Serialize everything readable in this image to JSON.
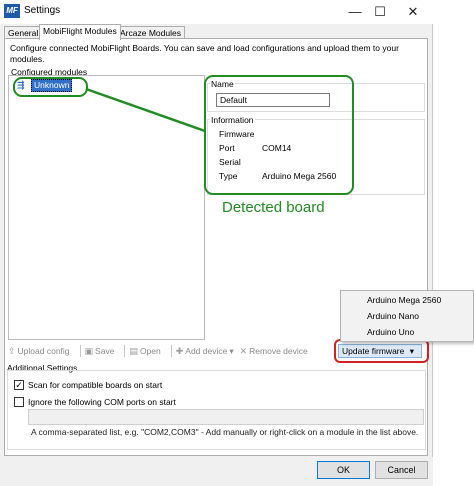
{
  "window": {
    "title": "Settings",
    "icon_text": "MF",
    "minimize_glyph": "—",
    "maximize_glyph": "☐",
    "close_glyph": "✕"
  },
  "tabs": [
    {
      "label": "General"
    },
    {
      "label": "MobiFlight Modules"
    },
    {
      "label": "Arcaze Modules"
    }
  ],
  "description": "Configure connected MobiFlight Boards. You can save and load configurations and upload them to your modules.",
  "modules": {
    "group_label": "Configured modules",
    "items": [
      {
        "label": "Unknown"
      }
    ]
  },
  "details": {
    "name_label": "Name",
    "name_value": "Default",
    "information_label": "Information",
    "firmware_label": "Firmware",
    "firmware_value": "",
    "port_label": "Port",
    "port_value": "COM14",
    "serial_label": "Serial",
    "serial_value": "",
    "type_label": "Type",
    "type_value": "Arduino Mega 2560"
  },
  "annotation": {
    "text": "Detected board",
    "green_color": "#228b22",
    "red_color": "#d32020"
  },
  "toolbar": {
    "upload_config": "Upload config",
    "save": "Save",
    "open": "Open",
    "add_device": "Add device",
    "remove_device": "Remove device",
    "update_firmware": "Update firmware",
    "dropdown_arrow": "▾"
  },
  "firmware_menu": {
    "items": [
      {
        "label": "Arduino Mega 2560"
      },
      {
        "label": "Arduino Nano"
      },
      {
        "label": "Arduino Uno"
      }
    ]
  },
  "additional_settings": {
    "label": "Additional Settings",
    "scan_label": "Scan for compatible boards on start",
    "scan_checked": true,
    "ignore_label": "Ignore the following COM ports on start",
    "ignore_checked": false,
    "com_ports_value": "",
    "hint": "A comma-separated list, e.g. \"COM2,COM3\" - Add manually or right-click on a module in the list above."
  },
  "footer": {
    "ok_label": "OK",
    "cancel_label": "Cancel"
  }
}
